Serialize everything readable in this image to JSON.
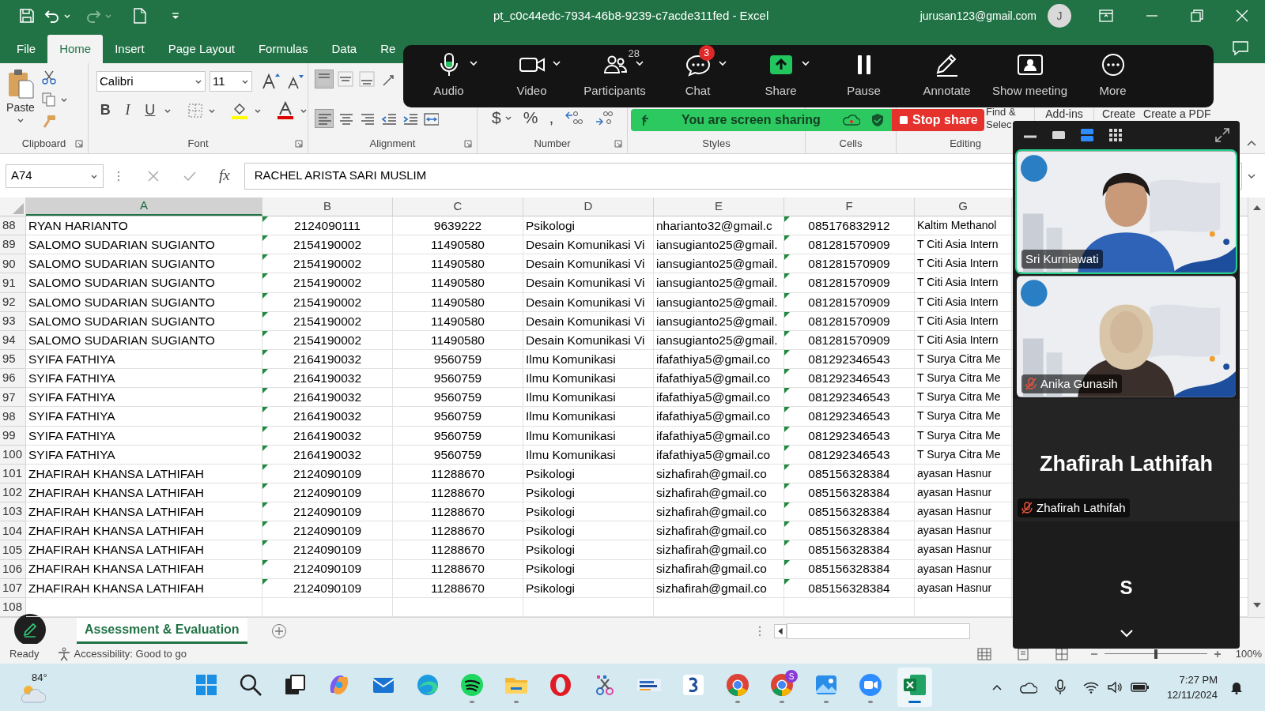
{
  "title_bar": {
    "title": "pt_c0c44edc-7934-46b8-9239-c7acde311fed  -  Excel",
    "account": "jurusan123@gmail.com",
    "avatar": "J"
  },
  "ribbon_tabs": [
    {
      "label": "File",
      "selected": false
    },
    {
      "label": "Home",
      "selected": true
    },
    {
      "label": "Insert",
      "selected": false
    },
    {
      "label": "Page Layout",
      "selected": false
    },
    {
      "label": "Formulas",
      "selected": false
    },
    {
      "label": "Data",
      "selected": false
    },
    {
      "label": "Re",
      "selected": false
    }
  ],
  "ribbon": {
    "groups": [
      {
        "kind": "clipboard",
        "label": "Clipboard",
        "launcher": true
      },
      {
        "kind": "font",
        "label": "Font",
        "launcher": true
      },
      {
        "kind": "alignment",
        "label": "Alignment",
        "launcher": true
      },
      {
        "kind": "number",
        "label": "Number",
        "launcher": true
      },
      {
        "kind": "styles",
        "label": "Styles"
      },
      {
        "kind": "cells",
        "label": "Cells"
      },
      {
        "kind": "editing",
        "label": "Editing"
      }
    ],
    "paste": "Paste",
    "font_name": "Calibri",
    "font_size": "11",
    "style_buttons": [
      "B",
      "I",
      "U"
    ],
    "alignment_rows": [
      [
        {
          "kind": "top",
          "selected": true
        },
        {
          "kind": "middle",
          "selected": false
        },
        {
          "kind": "bottom",
          "selected": false
        },
        {
          "kind": "orientation",
          "selected": false
        }
      ],
      [
        {
          "kind": "left",
          "selected": true
        },
        {
          "kind": "center",
          "selected": false
        },
        {
          "kind": "right",
          "selected": false
        },
        {
          "kind": "outdent",
          "selected": false
        },
        {
          "kind": "indent",
          "selected": false
        },
        {
          "kind": "merge",
          "selected": false
        }
      ]
    ],
    "number_symbols": [
      "$",
      "%",
      ","
    ],
    "find": "Find &",
    "select": "Selec",
    "addins": "Add-ins",
    "create": "Create",
    "create_pdf": "Create a PDF"
  },
  "formula_bar": {
    "name_box": "A74",
    "function_label": "fx",
    "content": "RACHEL ARISTA SARI MUSLIM"
  },
  "sheet": {
    "columns": [
      {
        "letter": "A",
        "selected": true
      },
      {
        "letter": "B",
        "selected": false,
        "error_flag": true
      },
      {
        "letter": "C",
        "selected": false
      },
      {
        "letter": "D",
        "selected": false
      },
      {
        "letter": "E",
        "selected": false
      },
      {
        "letter": "F",
        "selected": false,
        "error_flag": true
      },
      {
        "letter": "G",
        "selected": false
      }
    ],
    "rows": [
      {
        "number": "88",
        "cells": [
          "RYAN HARIANTO",
          "2124090111",
          "9639222",
          "Psikologi",
          "nharianto32@gmail.c",
          "085176832912",
          "Kaltim Methanol"
        ]
      },
      {
        "number": "89",
        "cells": [
          "SALOMO SUDARIAN SUGIANTO",
          "2154190002",
          "11490580",
          "Desain Komunikasi Vi",
          "iansugianto25@gmail.",
          "081281570909",
          "T Citi Asia Intern"
        ]
      },
      {
        "number": "90",
        "cells": [
          "SALOMO SUDARIAN SUGIANTO",
          "2154190002",
          "11490580",
          "Desain Komunikasi Vi",
          "iansugianto25@gmail.",
          "081281570909",
          "T Citi Asia Intern"
        ]
      },
      {
        "number": "91",
        "cells": [
          "SALOMO SUDARIAN SUGIANTO",
          "2154190002",
          "11490580",
          "Desain Komunikasi Vi",
          "iansugianto25@gmail.",
          "081281570909",
          "T Citi Asia Intern"
        ]
      },
      {
        "number": "92",
        "cells": [
          "SALOMO SUDARIAN SUGIANTO",
          "2154190002",
          "11490580",
          "Desain Komunikasi Vi",
          "iansugianto25@gmail.",
          "081281570909",
          "T Citi Asia Intern"
        ]
      },
      {
        "number": "93",
        "cells": [
          "SALOMO SUDARIAN SUGIANTO",
          "2154190002",
          "11490580",
          "Desain Komunikasi Vi",
          "iansugianto25@gmail.",
          "081281570909",
          "T Citi Asia Intern"
        ]
      },
      {
        "number": "94",
        "cells": [
          "SALOMO SUDARIAN SUGIANTO",
          "2154190002",
          "11490580",
          "Desain Komunikasi Vi",
          "iansugianto25@gmail.",
          "081281570909",
          "T Citi Asia Intern"
        ]
      },
      {
        "number": "95",
        "cells": [
          "SYIFA FATHIYA",
          "2164190032",
          "9560759",
          "Ilmu Komunikasi",
          "ifafathiya5@gmail.co",
          "081292346543",
          "T Surya Citra Me"
        ]
      },
      {
        "number": "96",
        "cells": [
          "SYIFA FATHIYA",
          "2164190032",
          "9560759",
          "Ilmu Komunikasi",
          "ifafathiya5@gmail.co",
          "081292346543",
          "T Surya Citra Me"
        ]
      },
      {
        "number": "97",
        "cells": [
          "SYIFA FATHIYA",
          "2164190032",
          "9560759",
          "Ilmu Komunikasi",
          "ifafathiya5@gmail.co",
          "081292346543",
          "T Surya Citra Me"
        ]
      },
      {
        "number": "98",
        "cells": [
          "SYIFA FATHIYA",
          "2164190032",
          "9560759",
          "Ilmu Komunikasi",
          "ifafathiya5@gmail.co",
          "081292346543",
          "T Surya Citra Me"
        ]
      },
      {
        "number": "99",
        "cells": [
          "SYIFA FATHIYA",
          "2164190032",
          "9560759",
          "Ilmu Komunikasi",
          "ifafathiya5@gmail.co",
          "081292346543",
          "T Surya Citra Me"
        ]
      },
      {
        "number": "100",
        "cells": [
          "SYIFA FATHIYA",
          "2164190032",
          "9560759",
          "Ilmu Komunikasi",
          "ifafathiya5@gmail.co",
          "081292346543",
          "T Surya Citra Me"
        ]
      },
      {
        "number": "101",
        "cells": [
          "ZHAFIRAH KHANSA LATHIFAH",
          "2124090109",
          "11288670",
          "Psikologi",
          "sizhafirah@gmail.co",
          "085156328384",
          "ayasan Hasnur"
        ]
      },
      {
        "number": "102",
        "cells": [
          "ZHAFIRAH KHANSA LATHIFAH",
          "2124090109",
          "11288670",
          "Psikologi",
          "sizhafirah@gmail.co",
          "085156328384",
          "ayasan Hasnur"
        ]
      },
      {
        "number": "103",
        "cells": [
          "ZHAFIRAH KHANSA LATHIFAH",
          "2124090109",
          "11288670",
          "Psikologi",
          "sizhafirah@gmail.co",
          "085156328384",
          "ayasan Hasnur"
        ]
      },
      {
        "number": "104",
        "cells": [
          "ZHAFIRAH KHANSA LATHIFAH",
          "2124090109",
          "11288670",
          "Psikologi",
          "sizhafirah@gmail.co",
          "085156328384",
          "ayasan Hasnur"
        ]
      },
      {
        "number": "105",
        "cells": [
          "ZHAFIRAH KHANSA LATHIFAH",
          "2124090109",
          "11288670",
          "Psikologi",
          "sizhafirah@gmail.co",
          "085156328384",
          "ayasan Hasnur"
        ]
      },
      {
        "number": "106",
        "cells": [
          "ZHAFIRAH KHANSA LATHIFAH",
          "2124090109",
          "11288670",
          "Psikologi",
          "sizhafirah@gmail.co",
          "085156328384",
          "ayasan Hasnur"
        ]
      },
      {
        "number": "107",
        "cells": [
          "ZHAFIRAH KHANSA LATHIFAH",
          "2124090109",
          "11288670",
          "Psikologi",
          "sizhafirah@gmail.co",
          "085156328384",
          "ayasan Hasnur"
        ]
      },
      {
        "number": "108"
      }
    ]
  },
  "sheet_tabs": [
    {
      "label": "Assessment & Evaluation",
      "selected": true
    }
  ],
  "status_bar": {
    "ready": "Ready",
    "accessibility": "Accessibility: Good to go",
    "zoom_slider": {
      "level": 0.5
    },
    "zoom": "100%"
  },
  "meeting_toolbar": {
    "buttons": [
      {
        "kind": "audio",
        "label": "Audio",
        "dropdown": true
      },
      {
        "kind": "video",
        "label": "Video",
        "dropdown": true
      },
      {
        "kind": "participants",
        "label": "Participants",
        "count": "28",
        "dropdown": true
      },
      {
        "kind": "chat",
        "label": "Chat",
        "badge": "3",
        "dropdown": true
      },
      {
        "kind": "share",
        "label": "Share",
        "dropdown": true
      },
      {
        "kind": "pause",
        "label": "Pause",
        "dropdown": false
      },
      {
        "kind": "annotate",
        "label": "Annotate",
        "dropdown": false
      },
      {
        "kind": "show_meeting",
        "label": "Show meeting",
        "dropdown": false
      },
      {
        "kind": "more",
        "label": "More",
        "dropdown": false
      }
    ]
  },
  "sharing_banner": {
    "message": "You are screen sharing",
    "stop_button": "Stop share"
  },
  "video_panel": {
    "views": [
      {
        "kind": "minimize",
        "selected": false
      },
      {
        "kind": "thumbnail",
        "selected": false
      },
      {
        "kind": "speaker",
        "selected": true
      },
      {
        "kind": "gallery",
        "selected": false
      }
    ],
    "tiles": [
      {
        "kind": "video",
        "name": "Sri Kurniawati",
        "active_speaker": true,
        "muted": false
      },
      {
        "kind": "video",
        "name": "Anika Gunasih",
        "active_speaker": false,
        "muted": true
      },
      {
        "kind": "avatar",
        "display_name": "Zhafirah Lathifah",
        "name": "Zhafirah Lathifah",
        "muted": true
      },
      {
        "kind": "initial",
        "initial": "S"
      }
    ]
  },
  "taskbar": {
    "weather": "84°",
    "apps": [
      {
        "kind": "start"
      },
      {
        "kind": "search"
      },
      {
        "kind": "task_view"
      },
      {
        "kind": "swirl"
      },
      {
        "kind": "mail"
      },
      {
        "kind": "browser_wave"
      },
      {
        "kind": "music",
        "running": true
      },
      {
        "kind": "folder",
        "running": true
      },
      {
        "kind": "ring"
      },
      {
        "kind": "scissors"
      },
      {
        "kind": "banner"
      },
      {
        "kind": "tile"
      },
      {
        "kind": "chrome",
        "running": true
      },
      {
        "kind": "chrome",
        "running": true,
        "badge": "S"
      },
      {
        "kind": "photos",
        "running": true
      },
      {
        "kind": "camera",
        "running": true
      },
      {
        "kind": "sheet",
        "running": true,
        "active": true
      }
    ],
    "time": "7:27 PM",
    "date": "12/11/2024"
  }
}
